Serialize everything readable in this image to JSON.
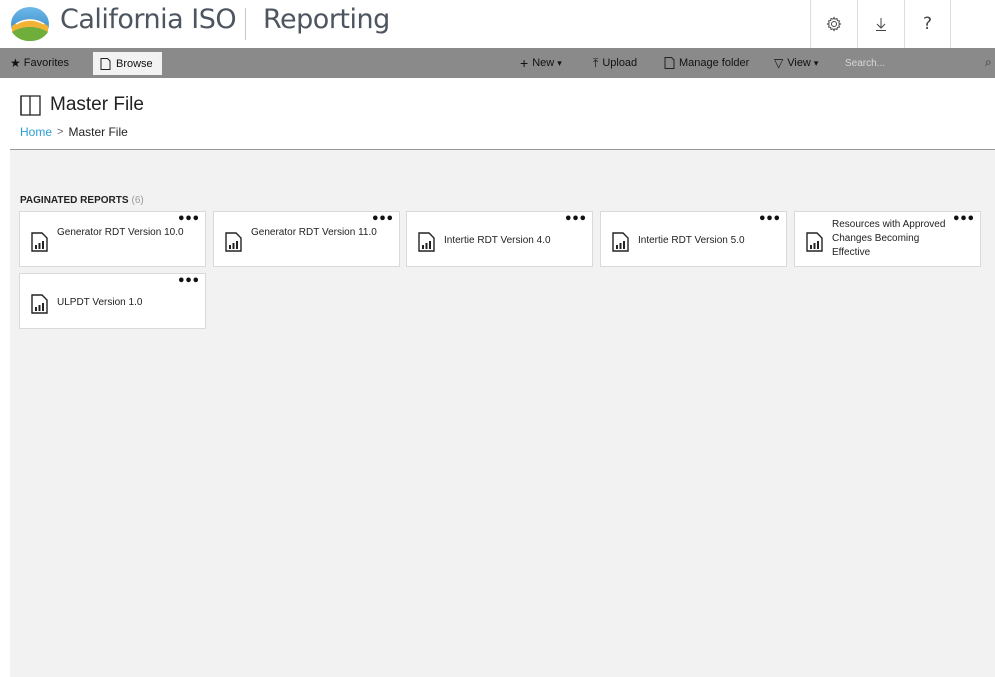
{
  "header": {
    "brand": "California ISO",
    "app_title": "Reporting",
    "buttons": [
      "settings",
      "download",
      "help"
    ],
    "help_glyph": "?",
    "download_glyph": "↓",
    "settings_glyph": "⚙"
  },
  "toolbar": {
    "favorites_label": "Favorites",
    "browse_label": "Browse",
    "new_label": "New",
    "upload_label": "Upload",
    "manage_label": "Manage folder",
    "view_label": "View",
    "search_placeholder": "Search..."
  },
  "page": {
    "title": "Master File",
    "breadcrumb_home": "Home",
    "breadcrumb_current": "Master File"
  },
  "section": {
    "label": "PAGINATED REPORTS",
    "count": "(6)"
  },
  "reports": [
    {
      "name": "Generator RDT Version 10.0"
    },
    {
      "name": "Generator RDT Version 11.0"
    },
    {
      "name": "Intertie RDT Version 4.0"
    },
    {
      "name": "Intertie RDT Version 5.0"
    },
    {
      "name": "Resources with Approved Changes Becoming Effective"
    },
    {
      "name": "ULPDT Version 1.0"
    }
  ],
  "colors": {
    "link": "#2aa0d8",
    "toolbar_bg": "#8a8a8a",
    "content_bg": "#f2f2f2"
  }
}
